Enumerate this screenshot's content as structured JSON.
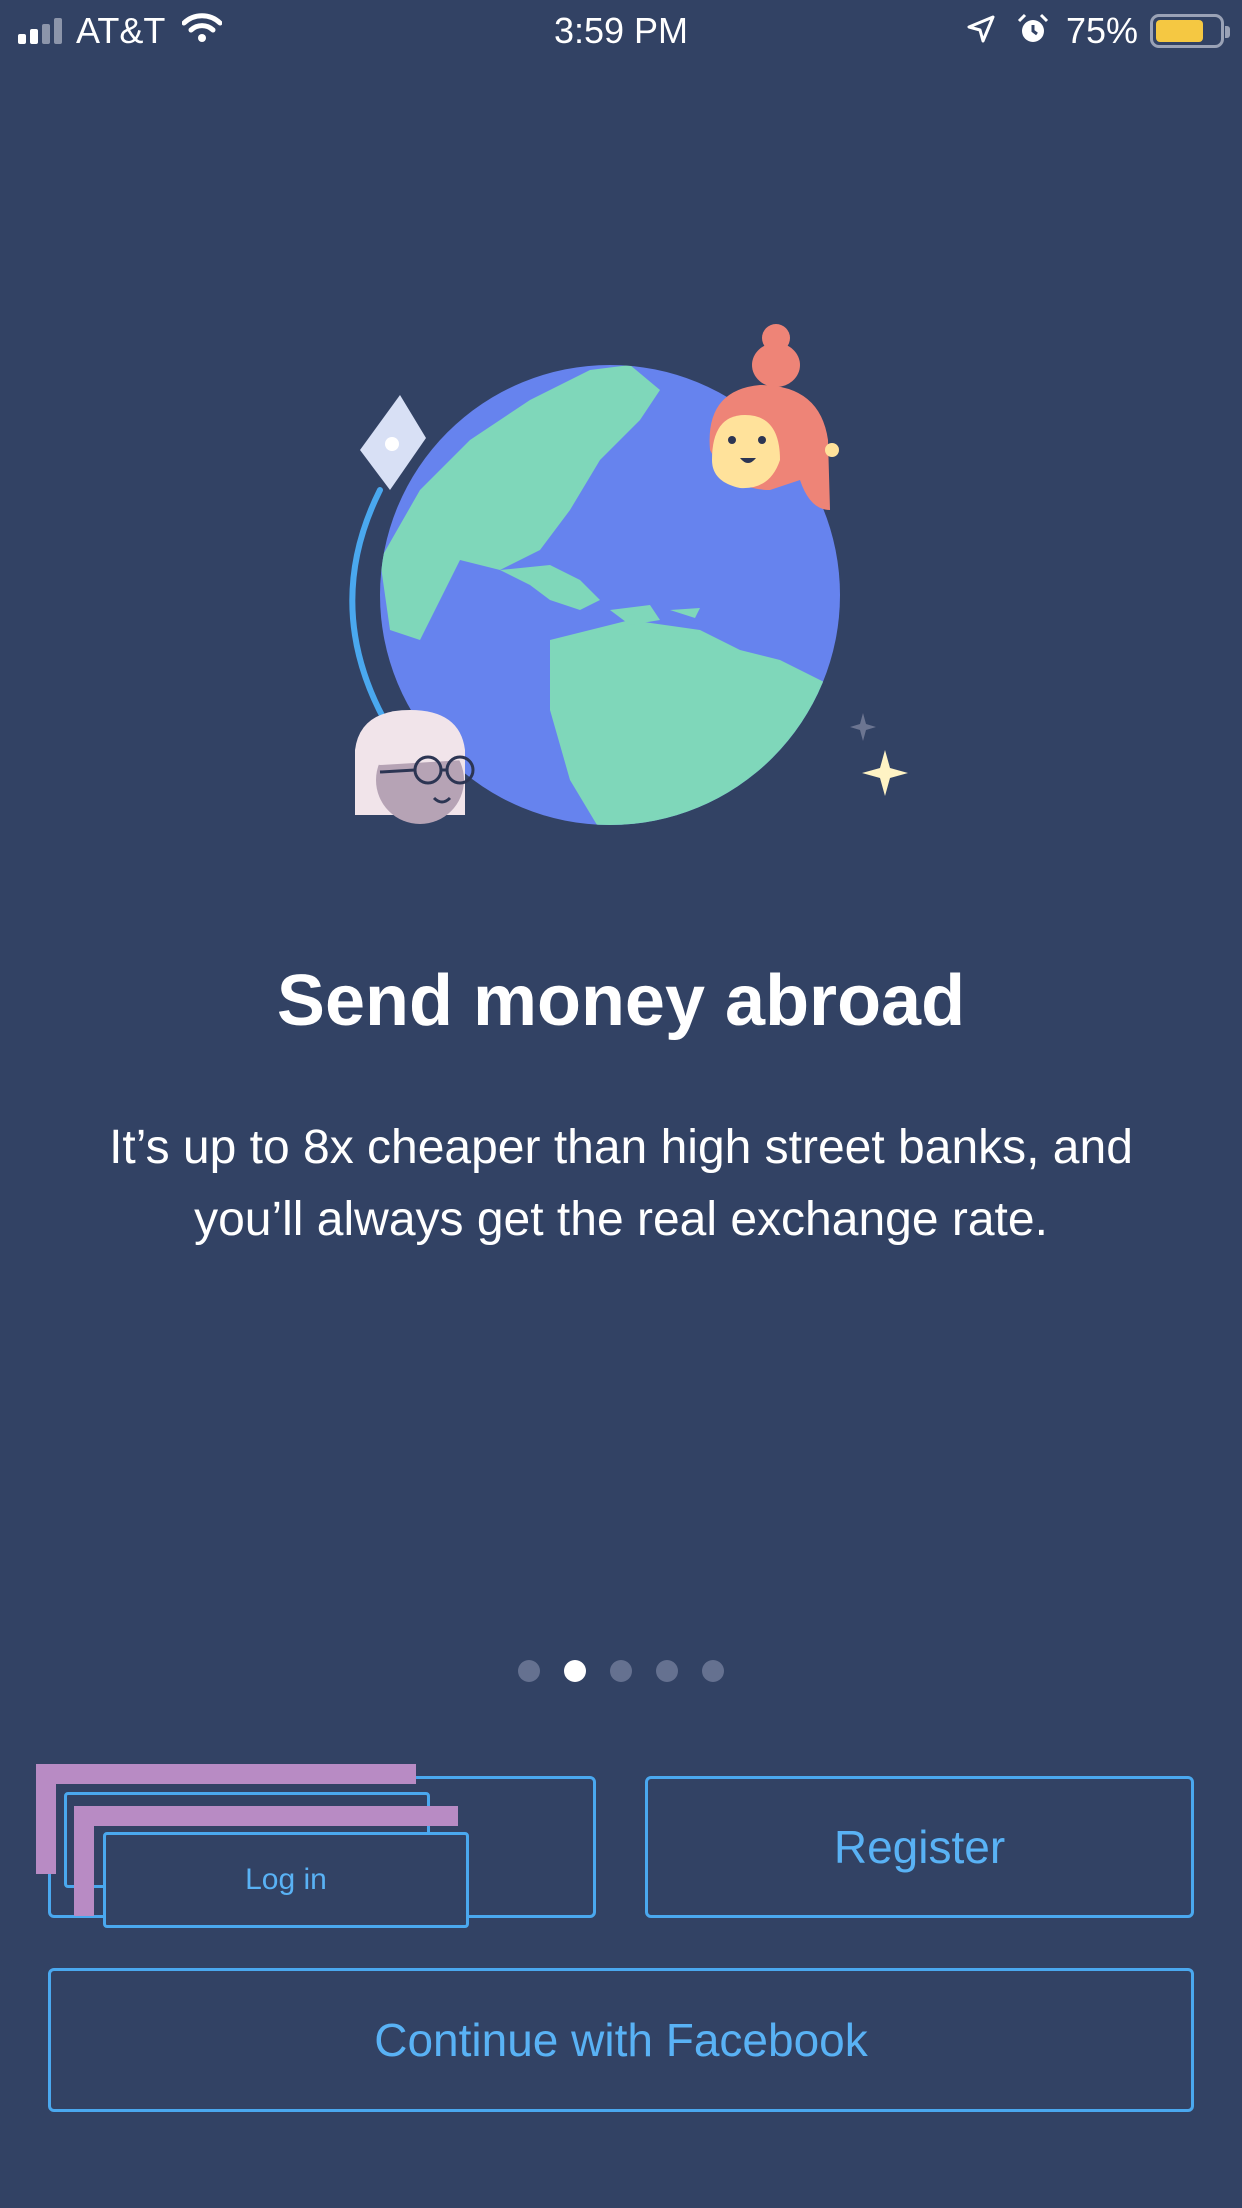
{
  "status_bar": {
    "carrier": "AT&T",
    "time": "3:59 PM",
    "battery_percent": "75%",
    "battery_level": 0.75,
    "signal_bars_active": 2,
    "icons": [
      "signal-icon",
      "wifi-icon",
      "location-arrow-icon",
      "alarm-clock-icon",
      "battery-icon"
    ]
  },
  "onboarding": {
    "headline": "Send money abroad",
    "subtext": "It’s up to 8x cheaper than high street banks, and you’ll always get the real exchange rate.",
    "illustration": "globe-with-people-illustration",
    "pager": {
      "total": 5,
      "active_index": 1
    }
  },
  "actions": {
    "login_label": "Log in",
    "register_label": "Register",
    "facebook_label": "Continue with Facebook"
  },
  "colors": {
    "background": "#324264",
    "accent": "#4aa8ef",
    "globe_ocean": "#6683ee",
    "globe_land": "#7fd7ba",
    "person_red": "#ee8477",
    "battery_fill": "#f5c842"
  }
}
